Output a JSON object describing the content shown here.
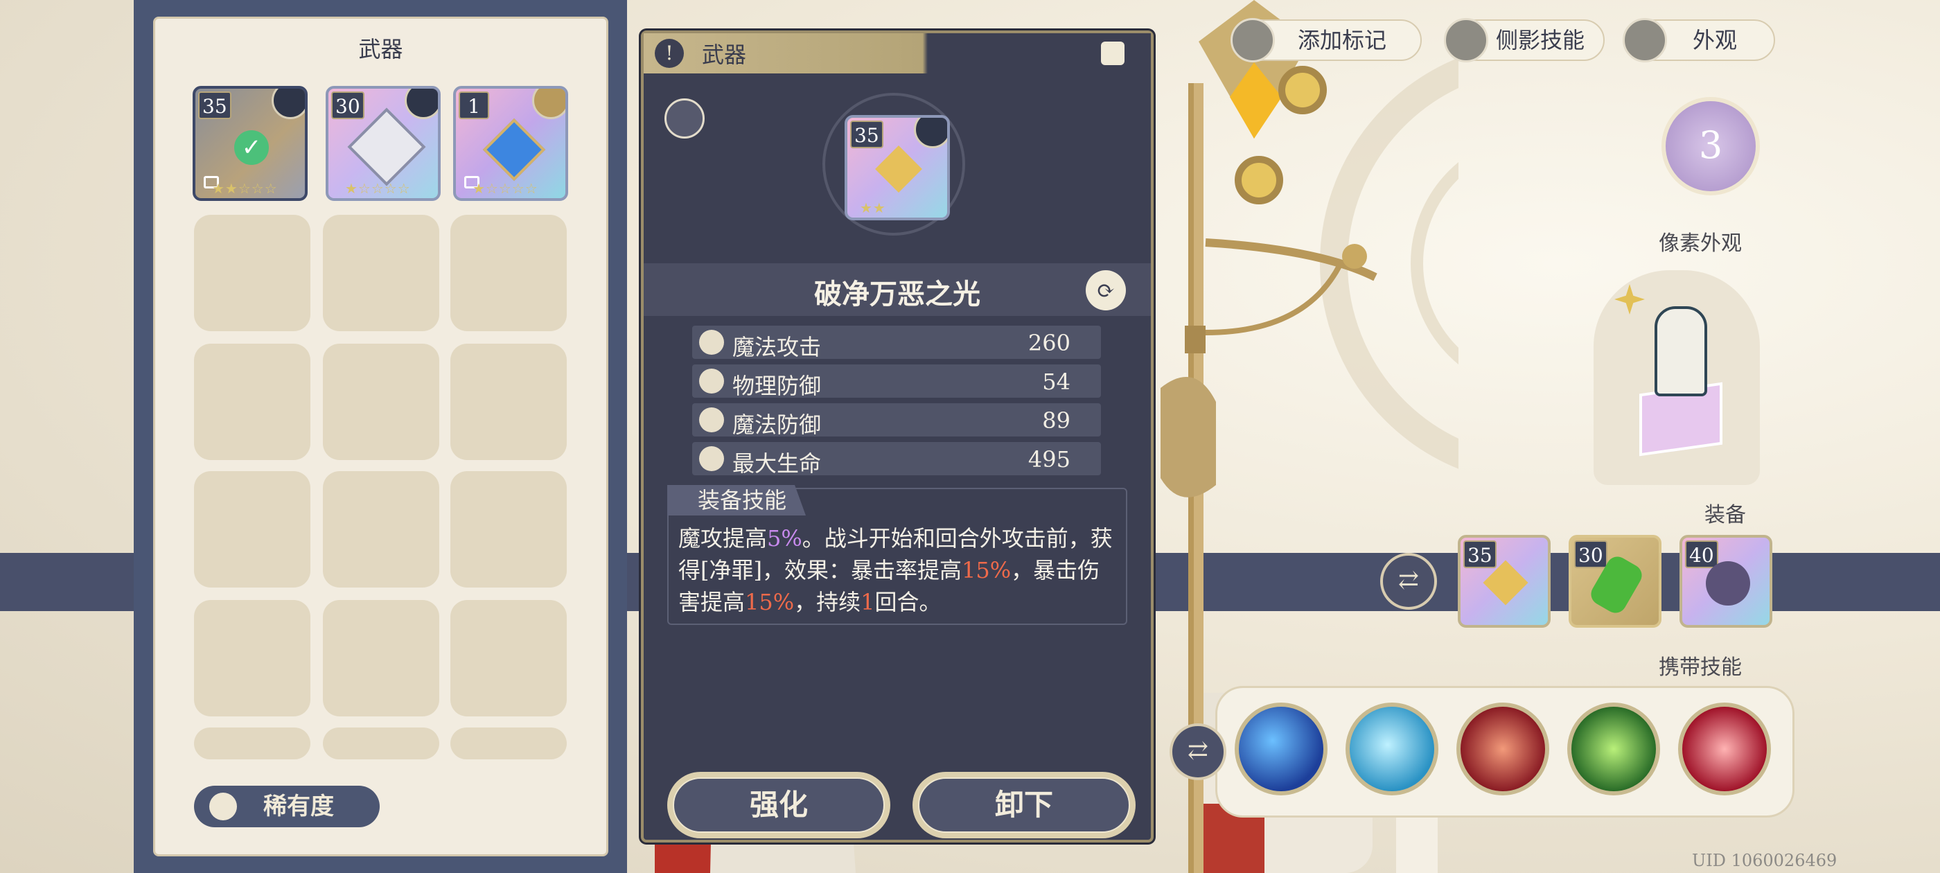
{
  "weapon_list": {
    "title": "武器",
    "items": [
      {
        "level": "35",
        "stars": "★★☆☆☆",
        "equipped": true
      },
      {
        "level": "30",
        "stars": "★☆☆☆☆",
        "equipped": false
      },
      {
        "level": "1",
        "stars": "★☆☆☆☆",
        "equipped": false
      }
    ],
    "rarity_label": "稀有度"
  },
  "detail": {
    "category": "武器",
    "icon_level": "35",
    "icon_stars": "★★",
    "name": "破净万恶之光",
    "stats": [
      {
        "label": "魔法攻击",
        "value": "260",
        "icon": "wand-icon"
      },
      {
        "label": "物理防御",
        "value": "54",
        "icon": "shield-icon"
      },
      {
        "label": "魔法防御",
        "value": "89",
        "icon": "wizard-hat-icon"
      },
      {
        "label": "最大生命",
        "value": "495",
        "icon": "heart-icon"
      }
    ],
    "skill_header": "装备技能",
    "skill_parts": {
      "p1": "魔攻提高",
      "v1": "5%",
      "p2": "。战斗开始和回合外攻击前，获得[净罪]，效果：暴击率提高",
      "v2": "15%",
      "p3": "，暴击伤害提高",
      "v3": "15%",
      "p4": "，持续",
      "v4": "1",
      "p5": "回合。"
    },
    "enhance_button": "强化",
    "unequip_button": "卸下"
  },
  "top_buttons": {
    "mark": "添加标记",
    "profile_skill": "侧影技能",
    "appearance": "外观"
  },
  "right": {
    "badge_number": "3",
    "pixel_appearance": "像素外观",
    "equipment": "装备",
    "equipment_levels": [
      "35",
      "30",
      "40"
    ],
    "carried_skills": "携带技能",
    "uid": "UID 1060026469"
  },
  "colors": {
    "panel_navy": "#4a5674",
    "detail_bg": "#3c3f52",
    "gold": "#c6b68c",
    "highlight_purple": "#c88aee",
    "highlight_red": "#ef6a4a"
  }
}
